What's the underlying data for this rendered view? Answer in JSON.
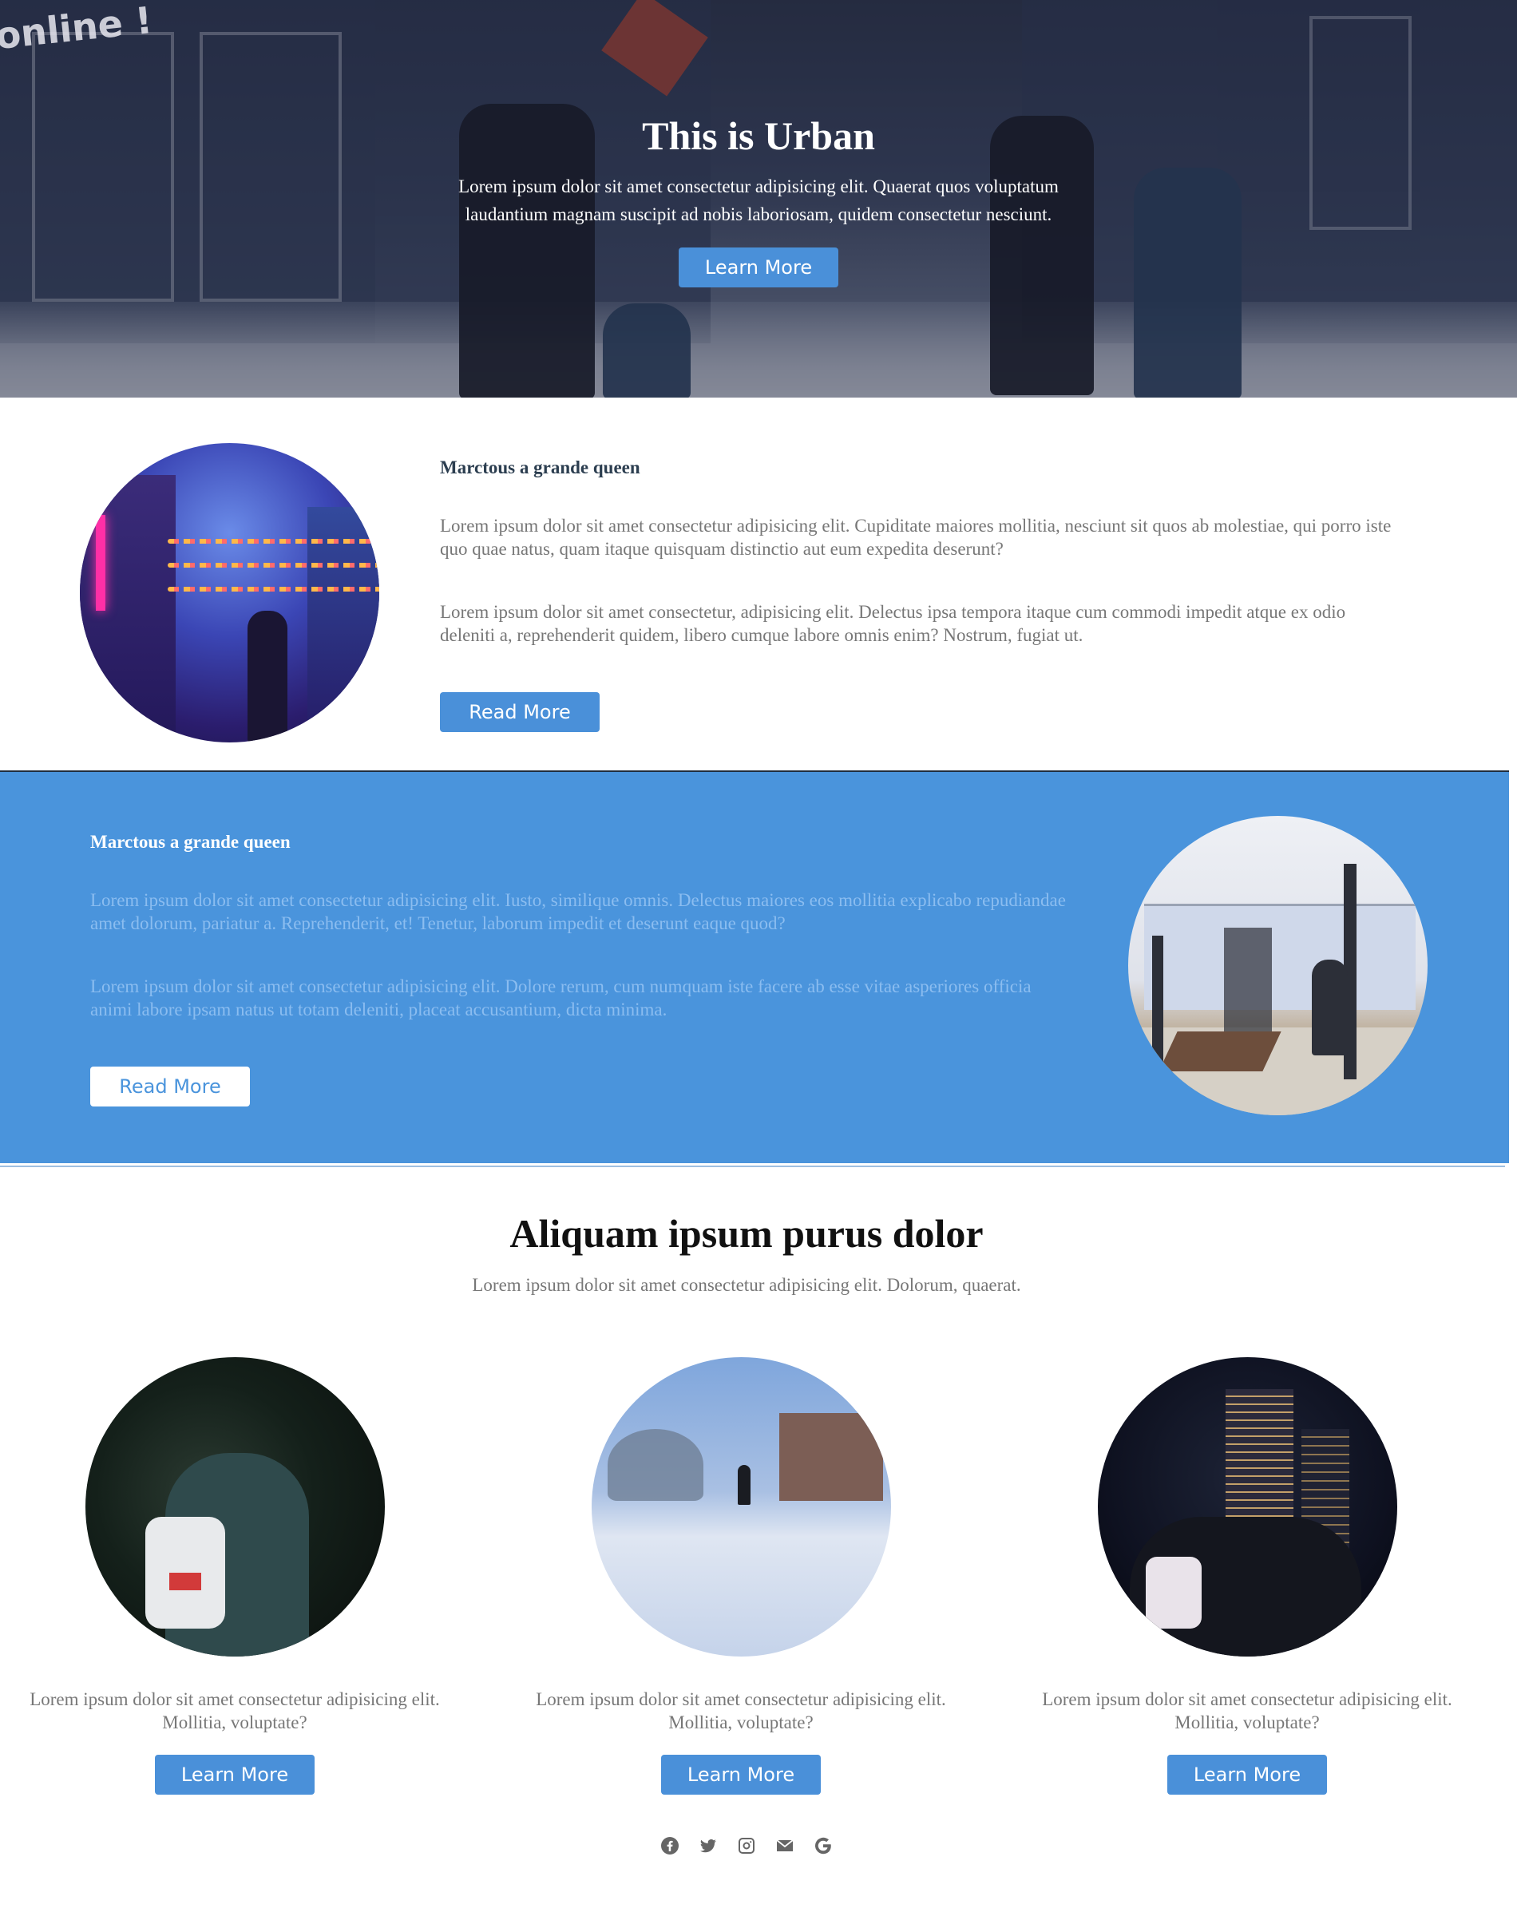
{
  "hero": {
    "logo_text": "online !",
    "title": "This is Urban",
    "text": "Lorem ipsum dolor sit amet consectetur adipisicing elit. Quaerat quos voluptatum laudantium magnam suscipit ad nobis laboriosam, quidem consectetur nesciunt.",
    "button_label": "Learn More"
  },
  "feature1": {
    "heading": "Marctous a grande queen",
    "para1": "Lorem ipsum dolor sit amet consectetur adipisicing elit. Cupiditate maiores mollitia, nesciunt sit quos ab molestiae, qui porro iste quo quae natus, quam itaque quisquam distinctio aut eum expedita deserunt?",
    "para2": "Lorem ipsum dolor sit amet consectetur, adipisicing elit. Delectus ipsa tempora itaque cum commodi impedit atque ex odio deleniti a, reprehenderit quidem, libero cumque labore omnis enim? Nostrum, fugiat ut.",
    "button_label": "Read More"
  },
  "feature2": {
    "heading": "Marctous a grande queen",
    "para1": "Lorem ipsum dolor sit amet consectetur adipisicing elit. Iusto, similique omnis. Delectus maiores eos mollitia explicabo repudiandae amet dolorum, pariatur a. Reprehenderit, et! Tenetur, laborum impedit et deserunt eaque quod?",
    "para2": "Lorem ipsum dolor sit amet consectetur adipisicing elit. Dolore rerum, cum numquam iste facere ab esse vitae asperiores officia animi labore ipsam natus ut totam deleniti, placeat accusantium, dicta minima.",
    "button_label": "Read More"
  },
  "section": {
    "title": "Aliquam ipsum purus dolor",
    "subtitle": "Lorem ipsum dolor sit amet consectetur adipisicing elit. Dolorum, quaerat."
  },
  "cards": [
    {
      "text": "Lorem ipsum dolor sit amet consectetur adipisicing elit. Mollitia, voluptate?",
      "button_label": "Learn More"
    },
    {
      "text": "Lorem ipsum dolor sit amet consectetur adipisicing elit. Mollitia, voluptate?",
      "button_label": "Learn More"
    },
    {
      "text": "Lorem ipsum dolor sit amet consectetur adipisicing elit. Mollitia, voluptate?",
      "button_label": "Learn More"
    }
  ],
  "footer": {
    "icons": [
      "facebook-icon",
      "twitter-icon",
      "instagram-icon",
      "mail-icon",
      "google-icon"
    ]
  },
  "colors": {
    "accent": "#4a90d9",
    "feature_band": "#4a94dc",
    "muted_text": "#777777",
    "heading_dark": "#2c3e50"
  }
}
